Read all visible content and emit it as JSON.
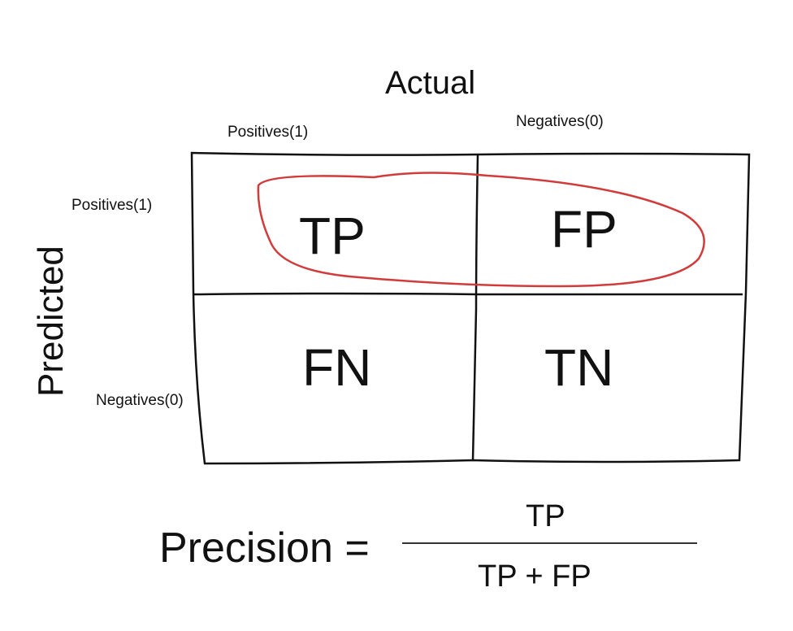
{
  "axes": {
    "actual_title": "Actual",
    "predicted_title": "Predicted",
    "actual_positive": "Positives(1)",
    "actual_negative": "Negatives(0)",
    "predicted_positive": "Positives(1)",
    "predicted_negative": "Negatives(0)"
  },
  "cells": {
    "tp": "TP",
    "fp": "FP",
    "fn": "FN",
    "tn": "TN"
  },
  "formula": {
    "lhs": "Precision =",
    "numerator": "TP",
    "denominator": "TP + FP"
  },
  "colors": {
    "ink": "#111111",
    "highlight": "#d23b3b"
  }
}
